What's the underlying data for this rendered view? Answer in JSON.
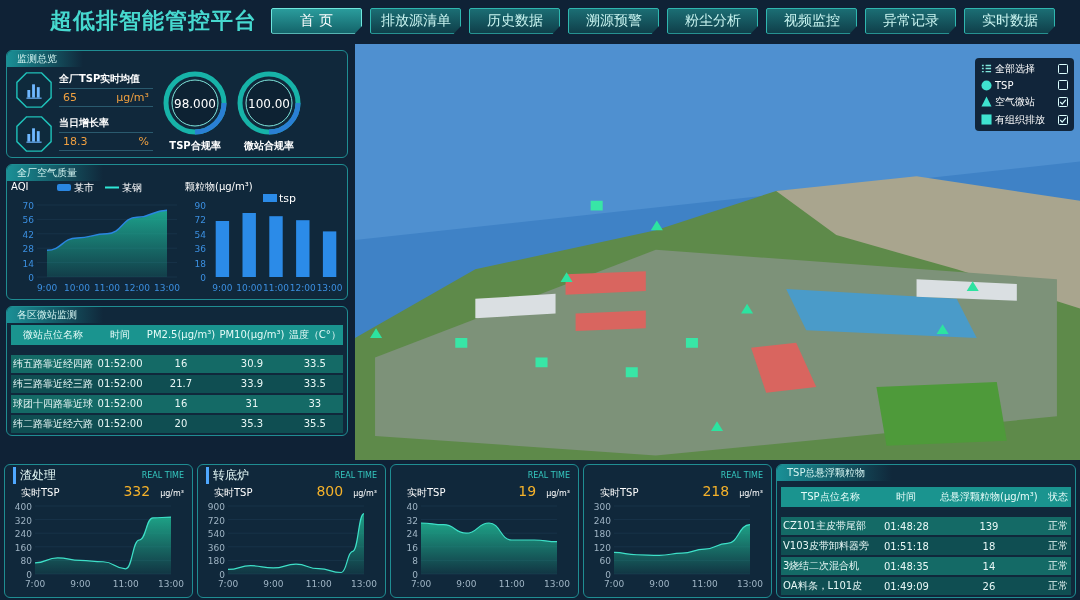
{
  "header": {
    "title": "超低排智能管控平台",
    "nav": [
      {
        "label": "首 页",
        "selected": true
      },
      {
        "label": "排放源清单",
        "selected": false
      },
      {
        "label": "历史数据",
        "selected": false
      },
      {
        "label": "溯源预警",
        "selected": false
      },
      {
        "label": "粉尘分析",
        "selected": false
      },
      {
        "label": "视频监控",
        "selected": false
      },
      {
        "label": "异常记录",
        "selected": false
      },
      {
        "label": "实时数据",
        "selected": false
      }
    ]
  },
  "overview": {
    "title": "监测总览",
    "metrics": [
      {
        "label": "全厂TSP实时均值",
        "value": "65",
        "unit": "μg/m³"
      },
      {
        "label": "当日增长率",
        "value": "18.3",
        "unit": "%"
      }
    ],
    "gauges": [
      {
        "value": "98.000",
        "label": "TSP合规率"
      },
      {
        "value": "100.00",
        "label": "微站合规率"
      }
    ]
  },
  "air_quality": {
    "title": "全厂空气质量",
    "aqi_chart": {
      "chart_data": {
        "type": "area",
        "grid": true,
        "ylabel": "AQI",
        "categories": [
          "9:00",
          "10:00",
          "11:00",
          "12:00",
          "13:00"
        ],
        "ylim": [
          0,
          70
        ],
        "yticks": [
          0,
          14,
          28,
          42,
          56,
          70
        ],
        "series": [
          {
            "name": "某市",
            "color": "#2a86e0",
            "values": [
              26,
              38,
              42,
              58,
              65
            ]
          },
          {
            "name": "某钢",
            "color": "#2ee6d6",
            "values": [
              null,
              null,
              null,
              null,
              null
            ]
          }
        ]
      }
    },
    "particulate_chart": {
      "chart_data": {
        "type": "bar",
        "ylabel": "颗粒物(μg/m³)",
        "categories": [
          "9:00",
          "10:00",
          "11:00",
          "12:00",
          "13:00"
        ],
        "ylim": [
          0,
          90
        ],
        "yticks": [
          0,
          18,
          36,
          54,
          72,
          90
        ],
        "series": [
          {
            "name": "tsp",
            "color": "#2b8be8",
            "values": [
              70,
              80,
              76,
              71,
              57
            ]
          }
        ]
      }
    }
  },
  "micro_stations": {
    "title": "各区微站监测",
    "columns": [
      "微站点位名称",
      "时间",
      "PM2.5(μg/m³)",
      "PM10(μg/m³)",
      "温度（C°）"
    ],
    "rows": [
      [
        "纬五路靠近经四路",
        "01:52:00",
        "16",
        "30.9",
        "33.5"
      ],
      [
        "纬三路靠近经三路",
        "01:52:00",
        "21.7",
        "33.9",
        "33.5"
      ],
      [
        "球团十四路靠近球",
        "01:52:00",
        "16",
        "31",
        "33"
      ],
      [
        "纬二路靠近经六路",
        "01:52:00",
        "20",
        "35.3",
        "35.5"
      ]
    ]
  },
  "map": {
    "kind": "picture",
    "layers": [
      {
        "kind": "all",
        "label": "全部选择",
        "checked": false
      },
      {
        "kind": "circle",
        "label": "TSP",
        "checked": false
      },
      {
        "kind": "triangle",
        "label": "空气微站",
        "checked": true
      },
      {
        "kind": "square",
        "label": "有组织排放",
        "checked": true
      }
    ]
  },
  "realtime_panels": [
    {
      "title": "渣处理",
      "badge": "REAL TIME",
      "label": "实时TSP",
      "value": "332",
      "unit": "μg/m³",
      "chart_data": {
        "type": "area",
        "grid": true,
        "x": [
          7,
          8,
          9,
          10,
          11,
          11.6,
          12.2,
          13
        ],
        "xlim": [
          7,
          13
        ],
        "xticks": [
          {
            "value": 7,
            "label": "7:00"
          },
          {
            "value": 9,
            "label": "9:00"
          },
          {
            "value": 11,
            "label": "11:00"
          },
          {
            "value": 13,
            "label": "13:00"
          }
        ],
        "ylim": [
          0,
          400
        ],
        "yticks": [
          0,
          80,
          160,
          240,
          320,
          400
        ],
        "series": [
          {
            "color": "#3ee0c8",
            "values": [
              65,
              95,
              80,
              72,
              30,
              200,
              330,
              335
            ]
          }
        ]
      }
    },
    {
      "title": "转底炉",
      "badge": "REAL TIME",
      "label": "实时TSP",
      "value": "800",
      "unit": "μg/m³",
      "chart_data": {
        "type": "area",
        "grid": true,
        "x": [
          7,
          8,
          9,
          10,
          11,
          12,
          12.5,
          13
        ],
        "xlim": [
          7,
          13
        ],
        "xticks": [
          {
            "value": 7,
            "label": "7:00"
          },
          {
            "value": 9,
            "label": "9:00"
          },
          {
            "value": 11,
            "label": "11:00"
          },
          {
            "value": 13,
            "label": "13:00"
          }
        ],
        "ylim": [
          0,
          900
        ],
        "yticks": [
          0,
          180,
          360,
          540,
          720,
          900
        ],
        "series": [
          {
            "color": "#3ee0c8",
            "values": [
              60,
              110,
              80,
              130,
              70,
              20,
              300,
              800
            ]
          }
        ]
      }
    },
    {
      "badge": "REAL TIME",
      "label": "实时TSP",
      "value": "19",
      "unit": "μg/m³",
      "chart_data": {
        "type": "area",
        "grid": true,
        "x": [
          7,
          8,
          9,
          10,
          11,
          12,
          13
        ],
        "xlim": [
          7,
          13
        ],
        "xticks": [
          {
            "value": 7,
            "label": "7:00"
          },
          {
            "value": 9,
            "label": "9:00"
          },
          {
            "value": 11,
            "label": "11:00"
          },
          {
            "value": 13,
            "label": "13:00"
          }
        ],
        "ylim": [
          0,
          40
        ],
        "yticks": [
          0,
          8,
          16,
          24,
          32,
          40
        ],
        "series": [
          {
            "color": "#3ee0c8",
            "values": [
              30,
              29,
              24,
              30,
              20,
              20,
              19
            ]
          }
        ]
      }
    },
    {
      "badge": "REAL TIME",
      "label": "实时TSP",
      "value": "218",
      "unit": "μg/m³",
      "chart_data": {
        "type": "area",
        "grid": true,
        "x": [
          7,
          8,
          9,
          10,
          11,
          12,
          13
        ],
        "xlim": [
          7,
          13
        ],
        "xticks": [
          {
            "value": 7,
            "label": "7:00"
          },
          {
            "value": 9,
            "label": "9:00"
          },
          {
            "value": 11,
            "label": "11:00"
          },
          {
            "value": 13,
            "label": "13:00"
          }
        ],
        "ylim": [
          0,
          300
        ],
        "yticks": [
          0,
          60,
          120,
          180,
          240,
          300
        ],
        "series": [
          {
            "color": "#3ee0c8",
            "values": [
              95,
              85,
              82,
              92,
              110,
              135,
              218
            ]
          }
        ]
      }
    }
  ],
  "tsp_table": {
    "title": "TSP总悬浮颗粒物",
    "columns": [
      "TSP点位名称",
      "时间",
      "总悬浮颗粒物(μg/m³)",
      "状态"
    ],
    "rows": [
      [
        "CZ101主皮带尾部",
        "01:48:28",
        "139",
        "正常"
      ],
      [
        "V103皮带卸料器旁",
        "01:51:18",
        "18",
        "正常"
      ],
      [
        "3烧结二次混合机",
        "01:48:35",
        "14",
        "正常"
      ],
      [
        "OA料条，L101皮",
        "01:49:09",
        "26",
        "正常"
      ]
    ]
  }
}
